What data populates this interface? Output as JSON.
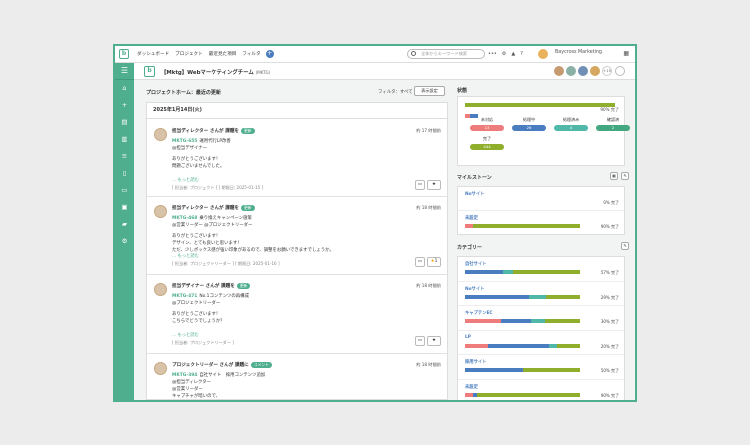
{
  "header": {
    "nav": [
      "ダッシュボード",
      "プロジェクト",
      "最近見た項目",
      "フィルタ"
    ],
    "search_placeholder": "全体からキーワード検索",
    "space": "Baycross Marketing"
  },
  "project": {
    "name": "【Mktg】Webマーケティングチーム",
    "key": "(MKTG)",
    "more_members": "+15"
  },
  "page": {
    "breadcrumb": "プロジェクトホーム：最近の更新",
    "filter": "フィルタ：すべて",
    "display_button": "表示設定",
    "date": "2025年1月14日(火)"
  },
  "activities": [
    {
      "actor": "担当ディレクター さんが 課題を",
      "badge": "更新",
      "time": "約 17 時間前",
      "issue_key": "MKTG-655",
      "issue_title": "運用代行LP改善",
      "mention": "@担当デザイナー",
      "lines": [
        "ありがとうございます！",
        "問題ございませんでした。"
      ],
      "readmore": "... もっと読む",
      "meta": "[ 担当者: プロジェクト ] [ 期限日: 2025-01-15 ]",
      "stars": ""
    },
    {
      "actor": "担当ディレクター さんが 課題を",
      "badge": "更新",
      "time": "約 18 時間前",
      "issue_key": "MKTG-468",
      "issue_title": "乗り換えキャンペーン施策",
      "mention": "@営業リーダー @プロジェクトリーダー",
      "lines": [
        "ありがとうございます！",
        "デザイン、とても良いと思います！",
        "ただ、少しボックス感が強い印象があるので、調整をお願いできますでしょうか。"
      ],
      "readmore": "... もっと読む",
      "meta": "[ 担当者: プロジェクトリーダー ] [ 期限日: 2025-01-16 ]",
      "stars": "1"
    },
    {
      "actor": "担当デザイナー さんが 課題を",
      "badge": "更新",
      "time": "約 18 時間前",
      "issue_key": "MKTG-471",
      "issue_title": "No.1コンテンツの再構成",
      "mention": "@プロジェクトリーダー",
      "lines": [
        "ありがとうございます！",
        "こちらでどうでしょうか？"
      ],
      "readmore": "... もっと読む",
      "meta": "[ 担当者: プロジェクトリーダー ]",
      "stars": ""
    },
    {
      "actor": "プロジェクトリーダー さんが 課題に",
      "badge": "コメント",
      "time": "約 18 時間前",
      "issue_key": "MKTG-394",
      "issue_title": "自社サイト　採用コンテンツ追加",
      "mention": "@担当ディレクター",
      "lines": [
        "@営業リーダー",
        "",
        "キャプチャが暗いので、"
      ],
      "readmore": "",
      "meta": "",
      "stars": ""
    }
  ],
  "status": {
    "title": "状態",
    "done_percent": "90% 完了",
    "items": [
      {
        "label": "未対応",
        "count": "13",
        "color": "#ee7c7c"
      },
      {
        "label": "処理中",
        "count": "26",
        "color": "#4a7cc0"
      },
      {
        "label": "処理済み",
        "count": "4",
        "color": "#50b8a9"
      },
      {
        "label": "確認済",
        "count": "2",
        "color": "#43a880"
      },
      {
        "label": "完了",
        "count": "444",
        "color": "#8fae2b"
      }
    ]
  },
  "milestones": {
    "title": "マイルストーン",
    "items": [
      {
        "name": "Noサイト",
        "pct": "0% 完了"
      },
      {
        "name": "未設定",
        "pct": "90% 完了"
      }
    ]
  },
  "categories": {
    "title": "カテゴリー",
    "items": [
      {
        "name": "自社サイト",
        "pct": "57% 完了"
      },
      {
        "name": "Noサイト",
        "pct": "29% 完了"
      },
      {
        "name": "キャプテンEC",
        "pct": "30% 完了"
      },
      {
        "name": "LP",
        "pct": "20% 完了"
      },
      {
        "name": "採用サイト",
        "pct": "50% 完了"
      },
      {
        "name": "未設定",
        "pct": "90% 完了"
      }
    ]
  }
}
